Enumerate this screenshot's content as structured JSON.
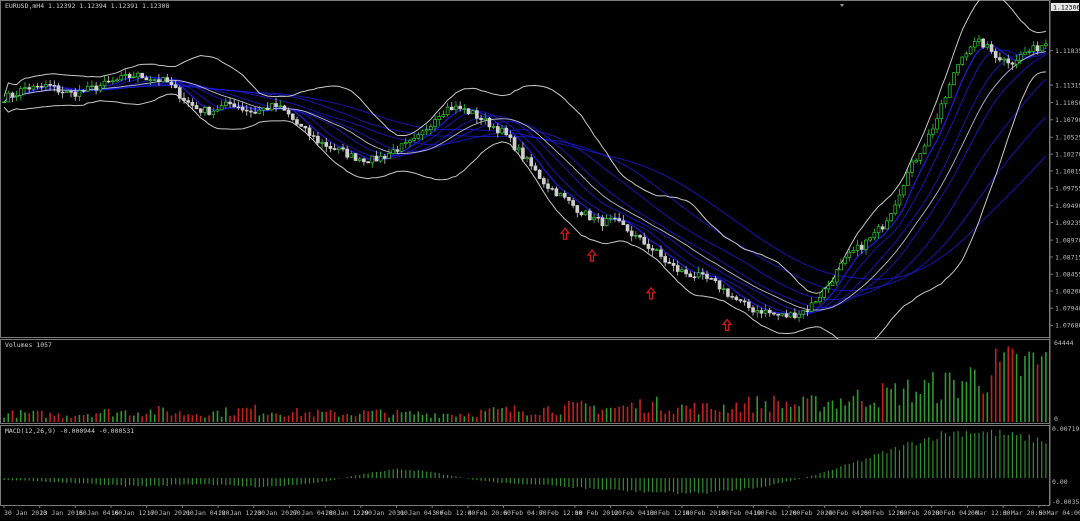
{
  "window": {
    "symbol_title": "EURUSD,mH4  1.12392 1.12394 1.12391 1.12308",
    "current_price_tag": "1.12306"
  },
  "price_panel": {
    "y_ticks": [
      "1.12306",
      "1.11835",
      "1.11315",
      "1.11050",
      "1.10790",
      "1.10525",
      "1.10270",
      "1.10015",
      "1.09755",
      "1.09490",
      "1.09235",
      "1.08970",
      "1.08715",
      "1.08455",
      "1.08200",
      "1.07940",
      "1.07680"
    ],
    "arrow_color": "#d01818",
    "bull_color": "#33cc33",
    "bear_color": "#cfcfcf",
    "ma_color": "#1c1cd8",
    "bands_color": "#c8c8c8"
  },
  "volume_panel": {
    "label": "Volumes 1057",
    "y_top": "64444",
    "y_bottom": "0",
    "up_color": "#2f9a2f",
    "down_color": "#c42020"
  },
  "macd_panel": {
    "label": "MACD(12,26,9) -0.000944 -0.000531",
    "y_top": "0.007195",
    "y_mid": "0.00",
    "y_bottom": "-0.003580",
    "bar_color": "#2f8f2f"
  },
  "time_axis": [
    "30 Jan 2020",
    "13 Jan 20:00",
    "15 Jan 04:00",
    "16 Jan 12:00",
    "17 Jan 20:00",
    "21 Jan 04:00",
    "22 Jan 12:00",
    "23 Jan 20:00",
    "27 Jan 04:00",
    "28 Jan 12:00",
    "29 Jan 20:00",
    "31 Jan 04:00",
    "3 Feb 12:00",
    "4 Feb 20:00",
    "6 Feb 04:00",
    "7 Feb 12:00",
    "10 Feb 20:00",
    "12 Feb 04:00",
    "13 Feb 12:00",
    "14 Feb 20:00",
    "18 Feb 04:00",
    "19 Feb 12:00",
    "20 Feb 20:00",
    "24 Feb 04:00",
    "25 Feb 12:00",
    "26 Feb 20:00",
    "28 Feb 04:00",
    "2 Mar 12:00",
    "3 Mar 20:00",
    "5 Mar 04:00"
  ],
  "chart_data": {
    "type": "candlestick",
    "title": "EURUSD,mH4  1.12392 1.12394 1.12391 1.12308",
    "ylim": [
      1.0755,
      1.1245
    ],
    "close_path": [
      1.1112,
      1.1118,
      1.1128,
      1.1126,
      1.1131,
      1.1124,
      1.1118,
      1.1121,
      1.1126,
      1.1131,
      1.1136,
      1.1142,
      1.1146,
      1.1144,
      1.114,
      1.1136,
      1.112,
      1.1104,
      1.1094,
      1.1092,
      1.1098,
      1.1104,
      1.1096,
      1.109,
      1.1096,
      1.11,
      1.109,
      1.1072,
      1.1058,
      1.1046,
      1.1038,
      1.1032,
      1.1024,
      1.102,
      1.1018,
      1.1024,
      1.1034,
      1.104,
      1.1048,
      1.1068,
      1.1088,
      1.1098,
      1.1096,
      1.109,
      1.108,
      1.107,
      1.106,
      1.104,
      1.102,
      1.1,
      1.098,
      1.0968,
      1.0955,
      1.0942,
      1.0932,
      1.0924,
      1.0926,
      1.0918,
      1.0904,
      1.0892,
      1.088,
      1.0864,
      1.0852,
      1.0846,
      1.0842,
      1.0836,
      1.0826,
      1.0812,
      1.08,
      1.0792,
      1.079,
      1.0784,
      1.0782,
      1.0786,
      1.0792,
      1.081,
      1.083,
      1.0856,
      1.0876,
      1.0888,
      1.0902,
      1.092,
      1.095,
      1.099,
      1.102,
      1.1048,
      1.1082,
      1.1124,
      1.1168,
      1.1192,
      1.1196,
      1.1182,
      1.117,
      1.1168,
      1.118,
      1.1186,
      1.1196
    ],
    "volume_envelope": [
      0.12,
      0.12,
      0.1,
      0.14,
      0.15,
      0.16,
      0.12,
      0.14,
      0.18,
      0.15,
      0.13,
      0.12,
      0.14,
      0.12,
      0.12,
      0.12,
      0.16,
      0.18,
      0.2,
      0.22,
      0.2,
      0.26,
      0.22,
      0.2,
      0.25,
      0.28,
      0.25,
      0.3,
      0.36,
      0.42,
      0.48,
      0.55,
      0.72,
      0.8,
      0.85
    ],
    "macd_envelope": [
      -0.0003,
      -0.0004,
      -0.0006,
      -0.0008,
      -0.001,
      -0.0012,
      -0.0012,
      -0.001,
      -0.0009,
      -0.0011,
      -0.0013,
      -0.0012,
      -0.0009,
      -0.0005,
      0.0003,
      0.001,
      0.0014,
      0.001,
      0.0004,
      -0.0003,
      -0.0007,
      -0.0009,
      -0.0011,
      -0.0014,
      -0.0017,
      -0.0019,
      -0.0021,
      -0.0022,
      -0.0023,
      -0.002,
      -0.0016,
      -0.001,
      -0.0002,
      0.0008,
      0.002,
      0.0032,
      0.0045,
      0.0058,
      0.0068,
      0.0071,
      0.0068,
      0.0062,
      0.0056
    ],
    "macd_ylim": [
      -0.00358,
      0.007195
    ],
    "signal_arrows_at": [
      1.093,
      1.0897,
      1.084,
      1.0792
    ]
  }
}
